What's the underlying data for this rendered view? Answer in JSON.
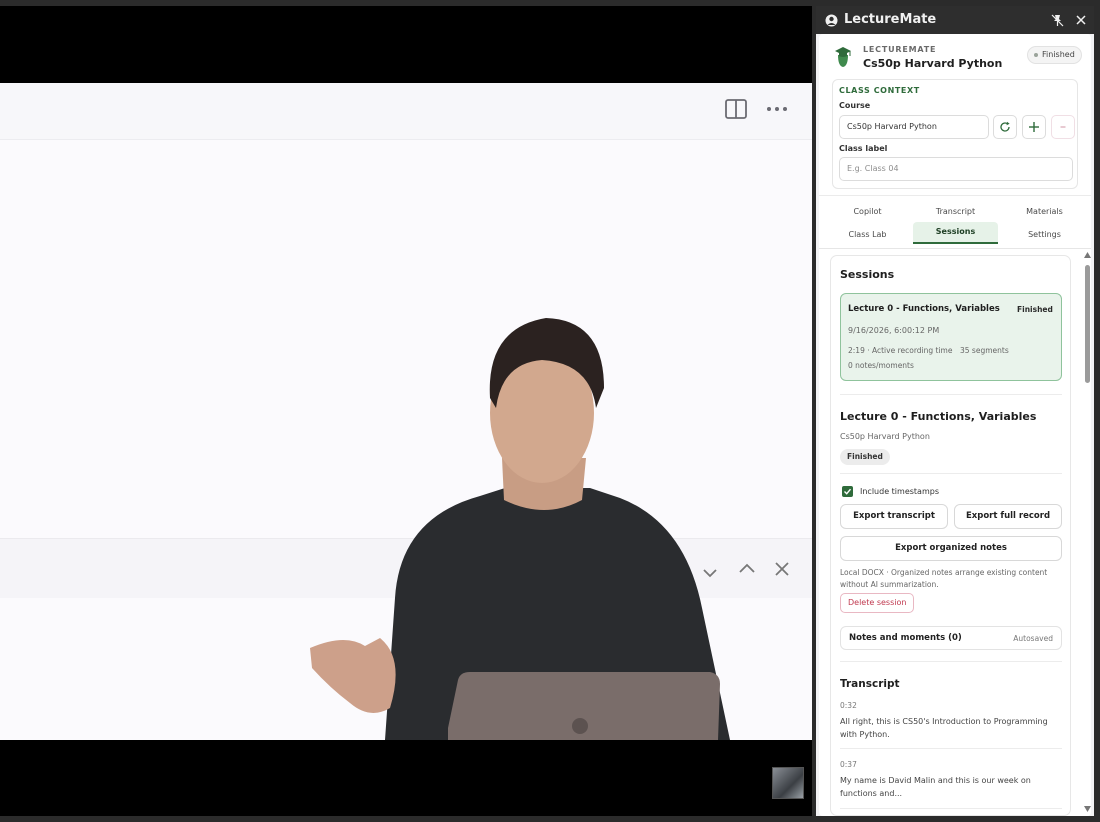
{
  "app": {
    "title": "LectureMate"
  },
  "header": {
    "app_label": "LECTUREMATE",
    "course_name": "Cs50p Harvard Python",
    "status": "Finished"
  },
  "class_context": {
    "heading": "CLASS CONTEXT",
    "course_label": "Course",
    "course_value": "Cs50p Harvard Python",
    "class_label_label": "Class label",
    "class_label_placeholder": "E.g. Class 04"
  },
  "tabs": [
    {
      "label": "Copilot"
    },
    {
      "label": "Transcript"
    },
    {
      "label": "Materials"
    },
    {
      "label": "Class Lab"
    },
    {
      "label": "Sessions",
      "active": true
    },
    {
      "label": "Settings"
    }
  ],
  "sessions": {
    "title": "Sessions",
    "items": [
      {
        "title": "Lecture 0 - Functions, Variables",
        "status": "Finished",
        "date": "9/16/2026, 6:00:12 PM",
        "duration": "2:19 · Active recording time",
        "segments": "35 segments",
        "notes": "0 notes/moments"
      }
    ]
  },
  "detail": {
    "title": "Lecture 0 - Functions, Variables",
    "course": "Cs50p Harvard Python",
    "status": "Finished",
    "include_timestamps_label": "Include timestamps",
    "include_timestamps_checked": true,
    "export_transcript_label": "Export transcript",
    "export_full_record_label": "Export full record",
    "export_notes_label": "Export organized notes",
    "export_note": "Local DOCX · Organized notes arrange existing content without AI summarization.",
    "delete_label": "Delete session",
    "notes_label": "Notes and moments (0)",
    "notes_status": "Autosaved"
  },
  "transcript": {
    "title": "Transcript",
    "segments": [
      {
        "time": "0:32",
        "text": "All right, this is CS50's Introduction to Programming with Python."
      },
      {
        "time": "0:37",
        "text": "My name is David Malin and this is our week on functions and..."
      }
    ]
  },
  "icons": {
    "app_logo": "user-circle-icon",
    "pin": "pin-off-icon",
    "close": "close-icon",
    "course_cap": "graduation-cap-icon",
    "refresh": "refresh-icon",
    "add": "plus-icon",
    "remove": "minus-icon",
    "panel_toggle": "split-panel-icon",
    "more": "more-horizontal-icon"
  },
  "colors": {
    "accent": "#2f6b3b",
    "active_item_bg": "#e9f3eb",
    "active_item_border": "#8fc39c",
    "danger": "#c0394f"
  }
}
